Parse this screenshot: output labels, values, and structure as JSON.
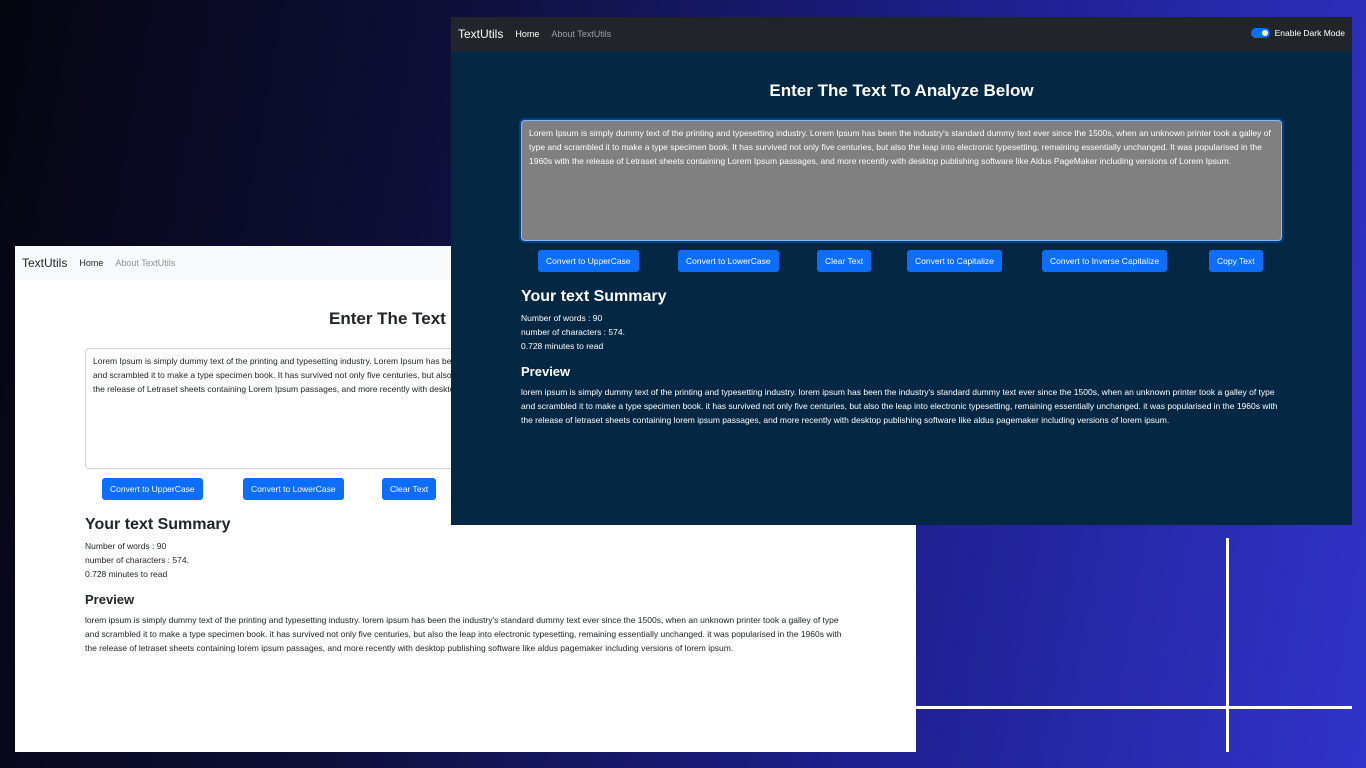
{
  "app": {
    "brand": "TextUtils",
    "nav": {
      "home": "Home",
      "about": "About TextUtils"
    }
  },
  "dark_mode_switch": {
    "label": "Enable Dark Mode",
    "checked": true
  },
  "page": {
    "heading": "Enter The Text To Analyze Below",
    "heading_light_visible": "Enter The Text",
    "textarea_value": "Lorem Ipsum is simply dummy text of the printing and typesetting industry. Lorem Ipsum has been the industry's standard dummy text ever since the 1500s, when an unknown printer took a galley of type and scrambled it to make a type specimen book. It has survived not only five centuries, but also the leap into electronic typesetting, remaining essentially unchanged. It was popularised in the 1960s with the release of Letraset sheets containing Lorem Ipsum passages, and more recently with desktop publishing software like Aldus PageMaker including versions of Lorem Ipsum.",
    "buttons": {
      "upper": "Convert to UpperCase",
      "lower": "Convert to LowerCase",
      "clear": "Clear Text",
      "capitalize": "Convert to Capitalize",
      "inverse": "Convert to Inverse Capitalize",
      "copy": "Copy Text"
    },
    "summary": {
      "title": "Your text Summary",
      "words": "Number of words : 90",
      "chars": "number of characters : 574.",
      "read": "0.728 minutes to read"
    },
    "preview": {
      "title": "Preview",
      "text": "lorem ipsum is simply dummy text of the printing and typesetting industry. lorem ipsum has been the industry's standard dummy text ever since the 1500s, when an unknown printer took a galley of type and scrambled it to make a type specimen book. it has survived not only five centuries, but also the leap into electronic typesetting, remaining essentially unchanged. it was popularised in the 1960s with the release of letraset sheets containing lorem ipsum passages, and more recently with desktop publishing software like aldus pagemaker including versions of lorem ipsum."
    }
  },
  "colors": {
    "primary": "#0d6efd",
    "dark_bg": "#042743",
    "dark_nav": "#212529",
    "textarea_dark": "#808080"
  }
}
